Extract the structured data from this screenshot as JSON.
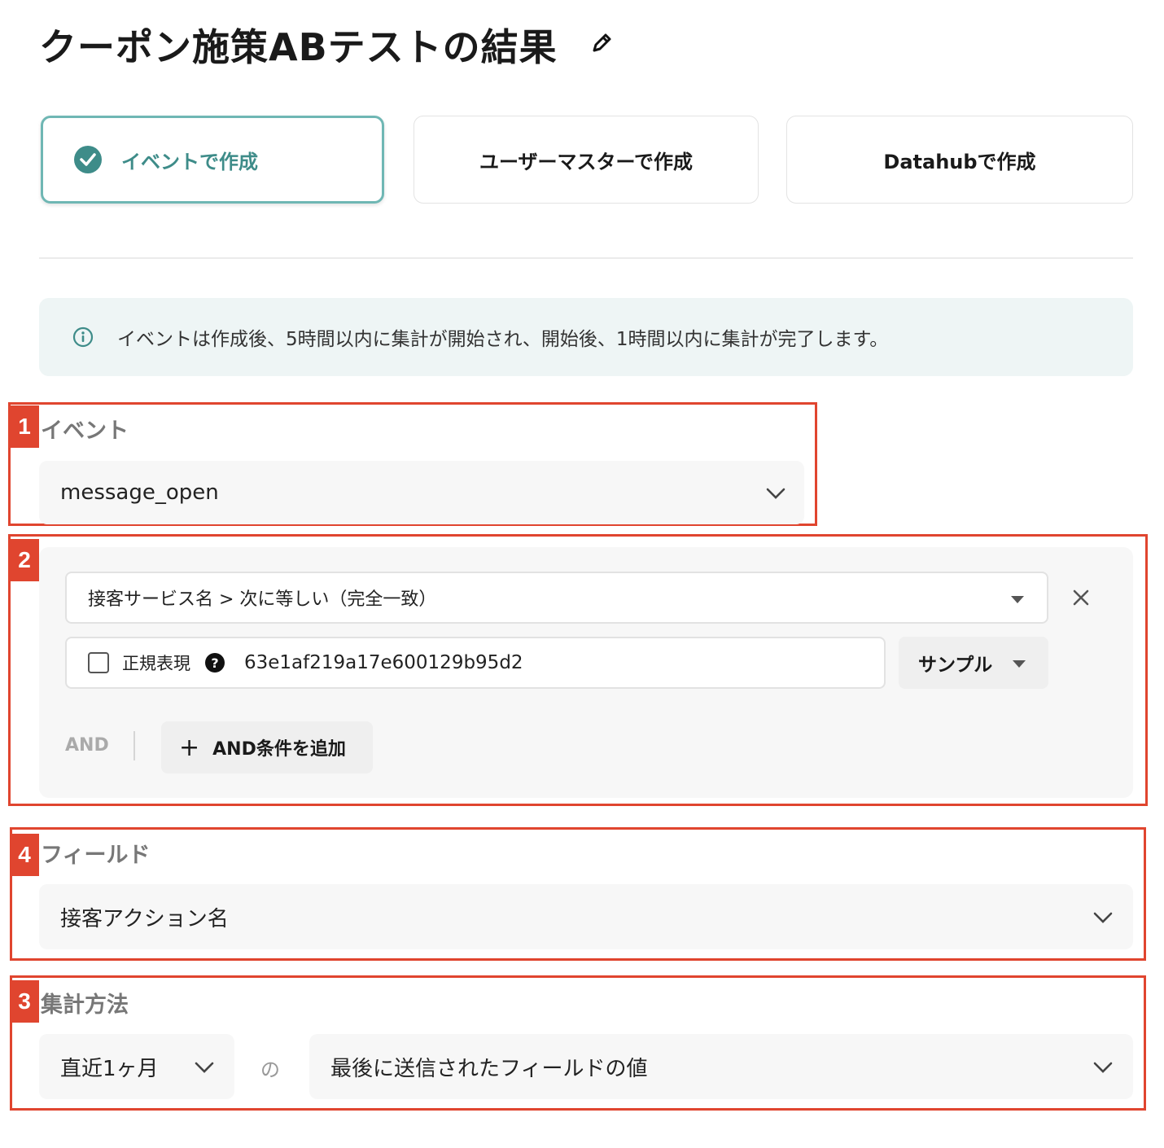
{
  "header": {
    "title": "クーポン施策ABテストの結果",
    "edit_icon": "pencil-icon"
  },
  "modes": [
    {
      "label": "イベントで作成",
      "selected": true
    },
    {
      "label": "ユーザーマスターで作成",
      "selected": false
    },
    {
      "label": "Datahubで作成",
      "selected": false
    }
  ],
  "info_banner": {
    "icon": "info-icon",
    "text": "イベントは作成後、5時間以内に集計が開始され、開始後、1時間以内に集計が完了します。"
  },
  "annotations": {
    "event": "1",
    "filter": "2",
    "field": "4",
    "aggregation": "3"
  },
  "event_section": {
    "label": "イベント",
    "value": "message_open"
  },
  "filter_section": {
    "condition": "接客サービス名 > 次に等しい（完全一致）",
    "regex_label": "正規表現",
    "help_glyph": "?",
    "value": "63e1af219a17e600129b95d2",
    "sample_label": "サンプル",
    "and_label": "AND",
    "add_and_label": "AND条件を追加",
    "plus": "+"
  },
  "field_section": {
    "label": "フィールド",
    "value": "接客アクション名"
  },
  "aggregation_section": {
    "label": "集計方法",
    "period": "直近1ヶ月",
    "connector": "の",
    "method": "最後に送信されたフィールドの値"
  },
  "colors": {
    "accent": "#3e8c89",
    "annotation": "#e0452f",
    "banner_bg": "#eef5f5"
  }
}
